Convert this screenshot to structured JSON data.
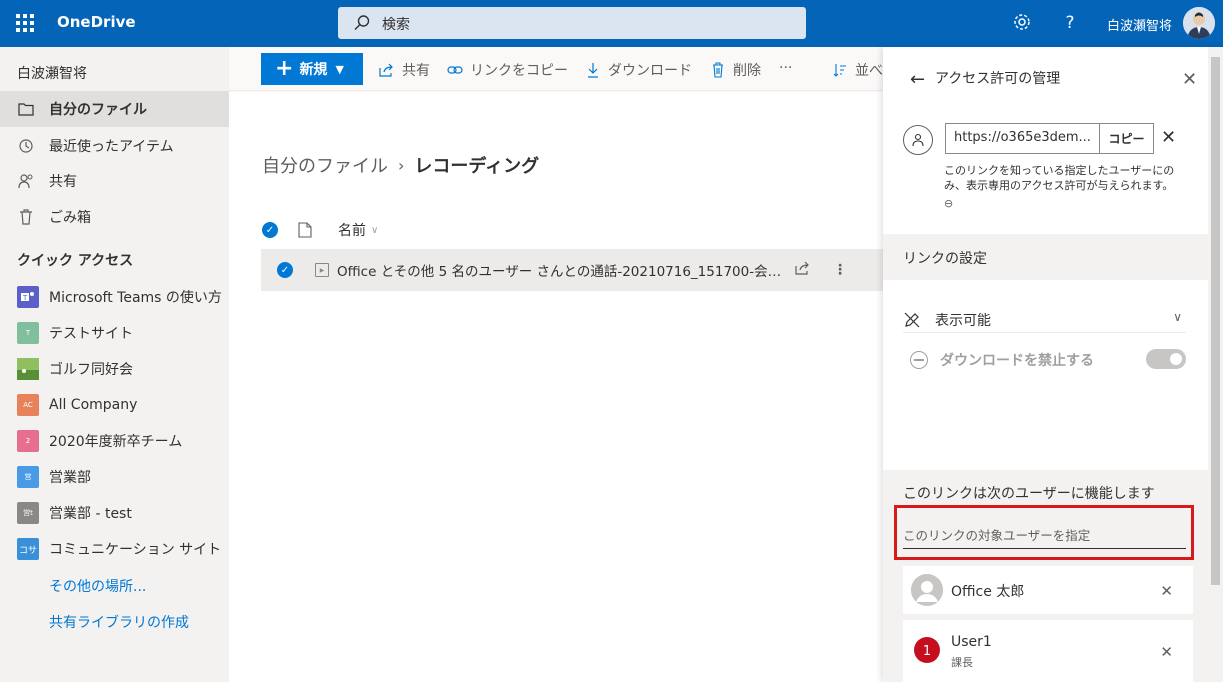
{
  "topbar": {
    "brand": "OneDrive",
    "search_placeholder": "検索",
    "user_name": "白波瀬智将",
    "settings_icon": "gear-icon",
    "help_label": "?"
  },
  "leftnav": {
    "owner": "白波瀬智将",
    "items": [
      {
        "label": "自分のファイル",
        "icon": "folder-icon",
        "selected": true
      },
      {
        "label": "最近使ったアイテム",
        "icon": "history-icon"
      },
      {
        "label": "共有",
        "icon": "people-icon"
      },
      {
        "label": "ごみ箱",
        "icon": "trash-icon"
      }
    ],
    "quick_access_title": "クイック アクセス",
    "quick_access": [
      {
        "label": "Microsoft Teams の使い方",
        "badge": "",
        "color": "#5b5fc7"
      },
      {
        "label": "テストサイト",
        "badge": "T",
        "color": "#7fbf9e"
      },
      {
        "label": "ゴルフ同好会",
        "badge": "",
        "color": "#6aa84f"
      },
      {
        "label": "All Company",
        "badge": "AC",
        "color": "#e8825a"
      },
      {
        "label": "2020年度新卒チーム",
        "badge": "2",
        "color": "#e66f8f"
      },
      {
        "label": "営業部",
        "badge": "営",
        "color": "#4a9be6"
      },
      {
        "label": "営業部 - test",
        "badge": "営t",
        "color": "#8a8886"
      },
      {
        "label": "コミュニケーション サイト",
        "badge": "コサ",
        "color": "#3a8fd9"
      }
    ],
    "more_places": "その他の場所...",
    "create_library": "共有ライブラリの作成"
  },
  "cmdbar": {
    "new_label": "新規",
    "share_label": "共有",
    "copy_link_label": "リンクをコピー",
    "download_label": "ダウンロード",
    "delete_label": "削除",
    "more_label": "···",
    "sort_label": "並べ"
  },
  "main": {
    "breadcrumb_root": "自分のファイル",
    "breadcrumb_current": "レコーディング",
    "column_name": "名前",
    "files": [
      {
        "name": "Office とその他 5 名のユーザー さんとの通話-20210716_151700-会議..."
      }
    ]
  },
  "panel": {
    "title": "アクセス許可の管理",
    "url": "https://o365e3dem...",
    "copy_label": "コピー",
    "description": "このリンクを知っている指定したユーザーにのみ、表示専用のアクセス許可が与えられます。",
    "link_settings": "リンクの設定",
    "permission": "表示可能",
    "block_download": "ダウンロードを禁止する",
    "works_for_title": "このリンクは次のユーザーに機能します",
    "input_placeholder": "このリンクの対象ユーザーを指定",
    "people": [
      {
        "name": "Office 太郎",
        "subtitle": "",
        "avatar": "default"
      },
      {
        "name": "User1",
        "subtitle": "課長",
        "badge": "1",
        "color": "#c50f1f"
      }
    ]
  }
}
